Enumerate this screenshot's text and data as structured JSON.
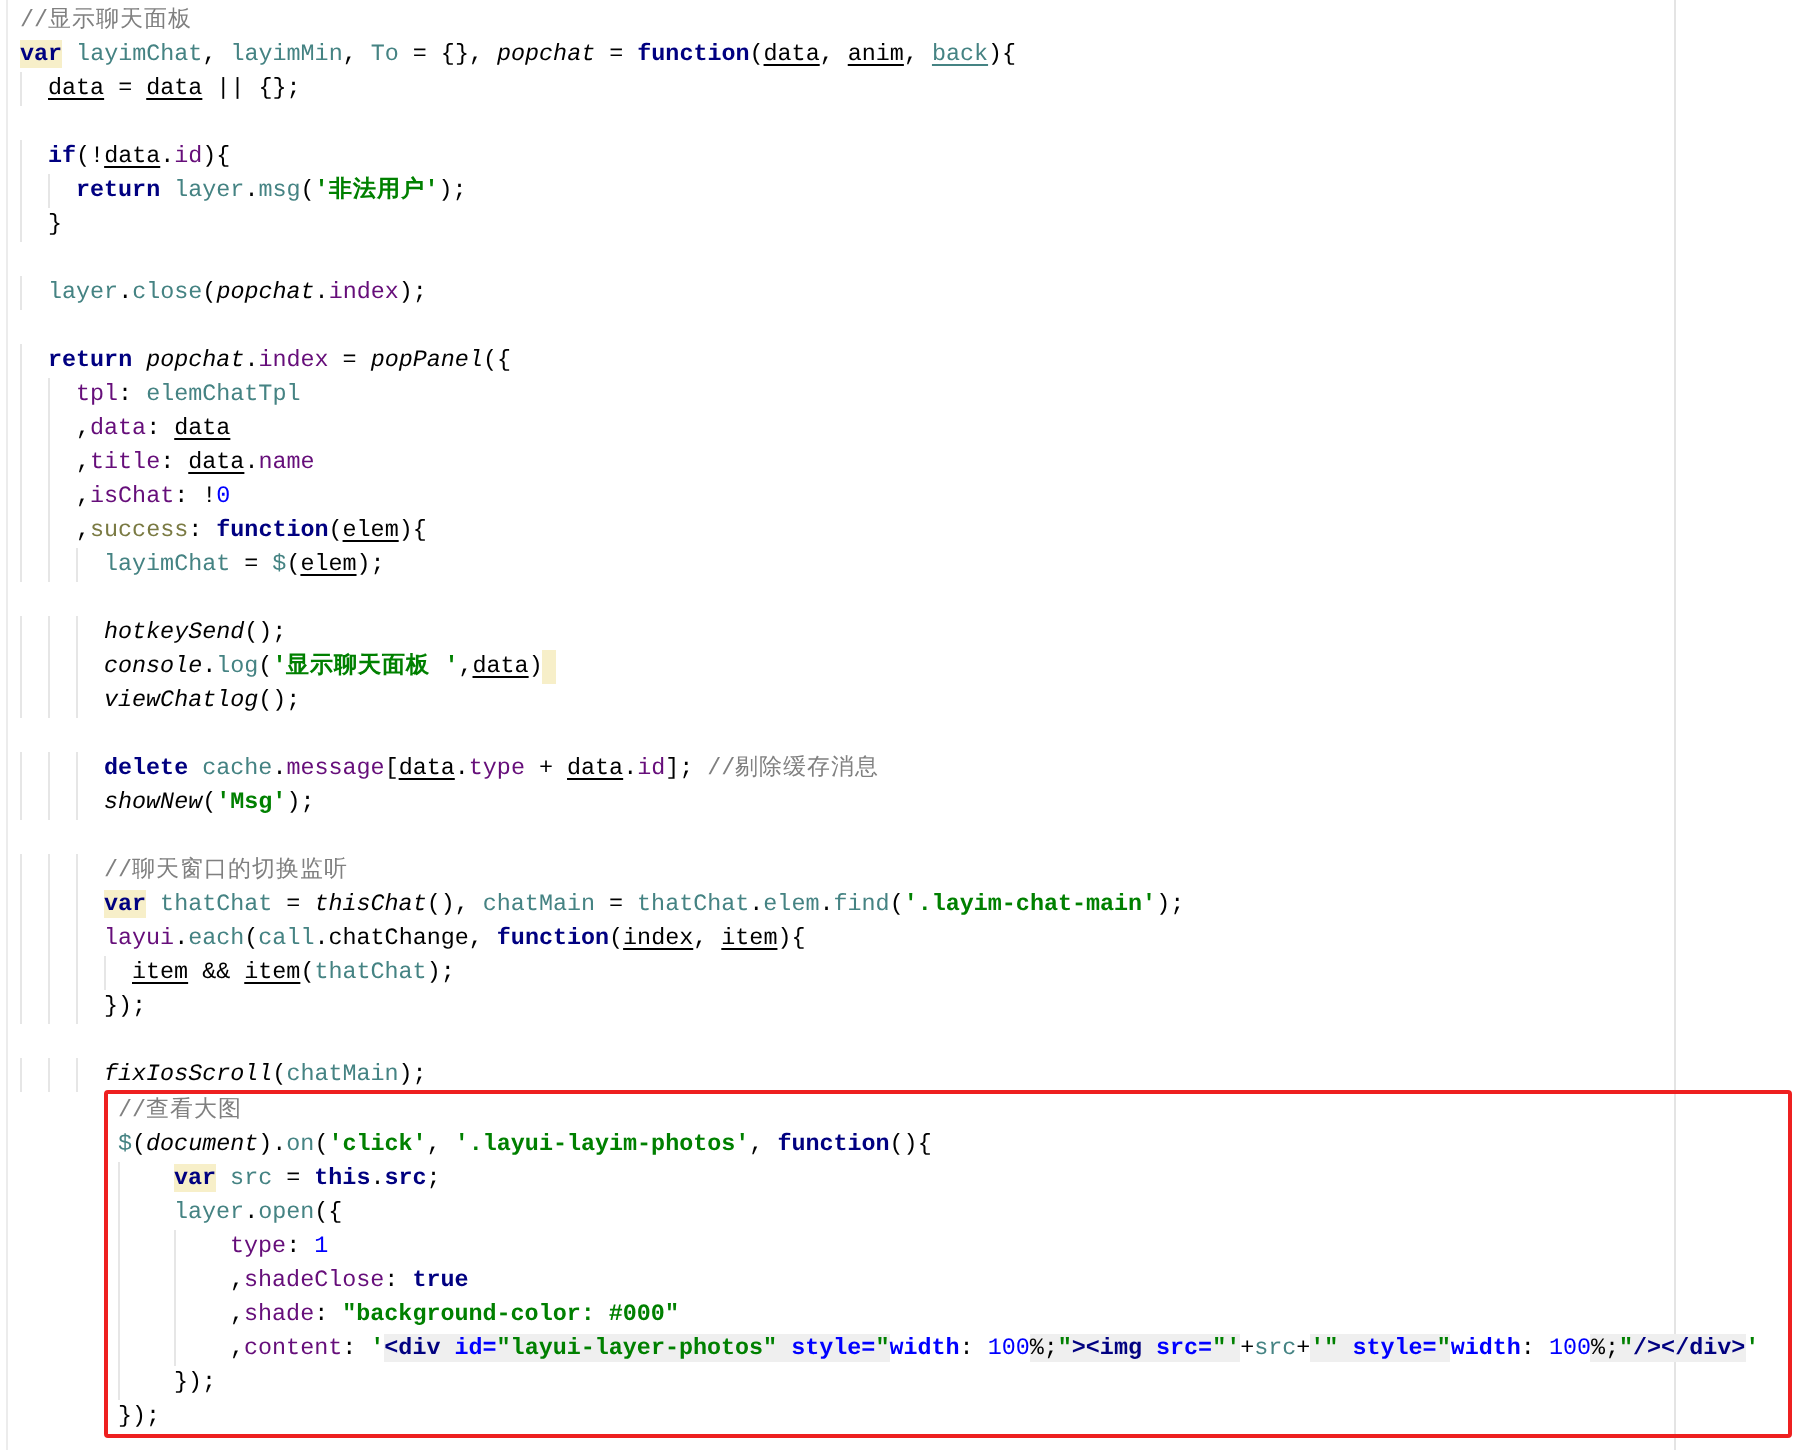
{
  "blocks": [
    {
      "boxed": false,
      "lines": [
        {
          "tokens": [
            {
              "kind": "comment",
              "text": "//显示聊天面板"
            }
          ]
        },
        {
          "tokens": [
            {
              "kind": "keyword",
              "text": "var",
              "marked": true
            },
            {
              "kind": "global",
              "text": " layimChat"
            },
            {
              "kind": "plain",
              "text": ", "
            },
            {
              "kind": "global",
              "text": "layimMin"
            },
            {
              "kind": "plain",
              "text": ", "
            },
            {
              "kind": "global",
              "text": "To"
            },
            {
              "kind": "plain",
              "text": " = {}, "
            },
            {
              "kind": "call",
              "text": "popchat"
            },
            {
              "kind": "plain",
              "text": " = "
            },
            {
              "kind": "keyword",
              "text": "function"
            },
            {
              "kind": "plain",
              "text": "("
            },
            {
              "kind": "plain",
              "text": "data",
              "underlined": true
            },
            {
              "kind": "plain",
              "text": ", "
            },
            {
              "kind": "plain",
              "text": "anim",
              "underlined": true
            },
            {
              "kind": "plain",
              "text": ", "
            },
            {
              "kind": "global",
              "text": "back",
              "underlined": true
            },
            {
              "kind": "plain",
              "text": "){"
            }
          ],
          "children": [
            {
              "tokens": [
                {
                  "kind": "plain",
                  "text": "data",
                  "underlined": true
                },
                {
                  "kind": "plain",
                  "text": " = "
                },
                {
                  "kind": "plain",
                  "text": "data",
                  "underlined": true
                },
                {
                  "kind": "plain",
                  "text": " || {};"
                }
              ]
            },
            {
              "blank_before": true,
              "tokens": [
                {
                  "kind": "keyword",
                  "text": "if"
                },
                {
                  "kind": "plain",
                  "text": "(!"
                },
                {
                  "kind": "plain",
                  "text": "data",
                  "underlined": true
                },
                {
                  "kind": "plain",
                  "text": "."
                },
                {
                  "kind": "field",
                  "text": "id"
                },
                {
                  "kind": "plain",
                  "text": "){"
                }
              ],
              "children": [
                {
                  "tokens": [
                    {
                      "kind": "keyword",
                      "text": "return"
                    },
                    {
                      "kind": "global",
                      "text": " layer"
                    },
                    {
                      "kind": "plain",
                      "text": "."
                    },
                    {
                      "kind": "global",
                      "text": "msg"
                    },
                    {
                      "kind": "plain",
                      "text": "("
                    },
                    {
                      "kind": "string",
                      "text": "'非法用户'"
                    },
                    {
                      "kind": "plain",
                      "text": ");"
                    }
                  ]
                }
              ]
            },
            {
              "tokens": [
                {
                  "kind": "plain",
                  "text": "}"
                }
              ]
            },
            {
              "blank_before": true,
              "tokens": [
                {
                  "kind": "global",
                  "text": "layer"
                },
                {
                  "kind": "plain",
                  "text": "."
                },
                {
                  "kind": "global",
                  "text": "close"
                },
                {
                  "kind": "plain",
                  "text": "("
                },
                {
                  "kind": "call",
                  "text": "popchat"
                },
                {
                  "kind": "plain",
                  "text": "."
                },
                {
                  "kind": "field",
                  "text": "index"
                },
                {
                  "kind": "plain",
                  "text": ");"
                }
              ]
            },
            {
              "blank_before": true,
              "tokens": [
                {
                  "kind": "keyword",
                  "text": "return"
                },
                {
                  "kind": "call",
                  "text": " popchat"
                },
                {
                  "kind": "plain",
                  "text": "."
                },
                {
                  "kind": "field",
                  "text": "index"
                },
                {
                  "kind": "plain",
                  "text": " = "
                },
                {
                  "kind": "call",
                  "text": "popPanel"
                },
                {
                  "kind": "plain",
                  "text": "({"
                }
              ],
              "children": [
                {
                  "tokens": [
                    {
                      "kind": "field",
                      "text": "tpl"
                    },
                    {
                      "kind": "plain",
                      "text": ": "
                    },
                    {
                      "kind": "global",
                      "text": "elemChatTpl"
                    }
                  ]
                },
                {
                  "tokens": [
                    {
                      "kind": "plain",
                      "text": ","
                    },
                    {
                      "kind": "field",
                      "text": "data"
                    },
                    {
                      "kind": "plain",
                      "text": ": "
                    },
                    {
                      "kind": "plain",
                      "text": "data",
                      "underlined": true
                    }
                  ]
                },
                {
                  "tokens": [
                    {
                      "kind": "plain",
                      "text": ","
                    },
                    {
                      "kind": "field",
                      "text": "title"
                    },
                    {
                      "kind": "plain",
                      "text": ": "
                    },
                    {
                      "kind": "plain",
                      "text": "data",
                      "underlined": true
                    },
                    {
                      "kind": "plain",
                      "text": "."
                    },
                    {
                      "kind": "field",
                      "text": "name"
                    }
                  ]
                },
                {
                  "tokens": [
                    {
                      "kind": "plain",
                      "text": ","
                    },
                    {
                      "kind": "field",
                      "text": "isChat"
                    },
                    {
                      "kind": "plain",
                      "text": ": !"
                    },
                    {
                      "kind": "number",
                      "text": "0"
                    }
                  ]
                },
                {
                  "tokens": [
                    {
                      "kind": "plain",
                      "text": ","
                    },
                    {
                      "kind": "member",
                      "text": "success"
                    },
                    {
                      "kind": "plain",
                      "text": ": "
                    },
                    {
                      "kind": "keyword",
                      "text": "function"
                    },
                    {
                      "kind": "plain",
                      "text": "("
                    },
                    {
                      "kind": "plain",
                      "text": "elem",
                      "underlined": true
                    },
                    {
                      "kind": "plain",
                      "text": "){"
                    }
                  ],
                  "children": [
                    {
                      "tokens": [
                        {
                          "kind": "global",
                          "text": "layimChat"
                        },
                        {
                          "kind": "plain",
                          "text": " = "
                        },
                        {
                          "kind": "global",
                          "text": "$"
                        },
                        {
                          "kind": "plain",
                          "text": "("
                        },
                        {
                          "kind": "plain",
                          "text": "elem",
                          "underlined": true
                        },
                        {
                          "kind": "plain",
                          "text": ");"
                        }
                      ]
                    },
                    {
                      "blank_before": true,
                      "tokens": [
                        {
                          "kind": "call",
                          "text": "hotkeySend"
                        },
                        {
                          "kind": "plain",
                          "text": "();"
                        }
                      ]
                    },
                    {
                      "caret": true,
                      "tokens": [
                        {
                          "kind": "call",
                          "text": "console"
                        },
                        {
                          "kind": "plain",
                          "text": "."
                        },
                        {
                          "kind": "global",
                          "text": "log"
                        },
                        {
                          "kind": "plain",
                          "text": "("
                        },
                        {
                          "kind": "string",
                          "text": "'显示聊天面板 '"
                        },
                        {
                          "kind": "plain",
                          "text": ","
                        },
                        {
                          "kind": "plain",
                          "text": "data",
                          "underlined": true
                        },
                        {
                          "kind": "plain",
                          "text": ")"
                        }
                      ]
                    },
                    {
                      "tokens": [
                        {
                          "kind": "call",
                          "text": "viewChatlog"
                        },
                        {
                          "kind": "plain",
                          "text": "();"
                        }
                      ]
                    },
                    {
                      "blank_before": true,
                      "tokens": [
                        {
                          "kind": "keyword",
                          "text": "delete"
                        },
                        {
                          "kind": "global",
                          "text": " cache"
                        },
                        {
                          "kind": "plain",
                          "text": "."
                        },
                        {
                          "kind": "field",
                          "text": "message"
                        },
                        {
                          "kind": "plain",
                          "text": "["
                        },
                        {
                          "kind": "plain",
                          "text": "data",
                          "underlined": true
                        },
                        {
                          "kind": "plain",
                          "text": "."
                        },
                        {
                          "kind": "field",
                          "text": "type"
                        },
                        {
                          "kind": "plain",
                          "text": " + "
                        },
                        {
                          "kind": "plain",
                          "text": "data",
                          "underlined": true
                        },
                        {
                          "kind": "plain",
                          "text": "."
                        },
                        {
                          "kind": "field",
                          "text": "id"
                        },
                        {
                          "kind": "plain",
                          "text": "]; "
                        },
                        {
                          "kind": "comment",
                          "text": "//剔除缓存消息"
                        }
                      ]
                    },
                    {
                      "tokens": [
                        {
                          "kind": "call",
                          "text": "showNew"
                        },
                        {
                          "kind": "plain",
                          "text": "("
                        },
                        {
                          "kind": "string",
                          "text": "'Msg'"
                        },
                        {
                          "kind": "plain",
                          "text": ");"
                        }
                      ]
                    },
                    {
                      "blank_before": true,
                      "tokens": [
                        {
                          "kind": "comment",
                          "text": "//聊天窗口的切换监听"
                        }
                      ]
                    },
                    {
                      "tokens": [
                        {
                          "kind": "keyword",
                          "text": "var",
                          "marked": true
                        },
                        {
                          "kind": "global",
                          "text": " thatChat"
                        },
                        {
                          "kind": "plain",
                          "text": " = "
                        },
                        {
                          "kind": "call",
                          "text": "thisChat"
                        },
                        {
                          "kind": "plain",
                          "text": "(), "
                        },
                        {
                          "kind": "global",
                          "text": "chatMain"
                        },
                        {
                          "kind": "plain",
                          "text": " = "
                        },
                        {
                          "kind": "global",
                          "text": "thatChat"
                        },
                        {
                          "kind": "plain",
                          "text": "."
                        },
                        {
                          "kind": "global",
                          "text": "elem"
                        },
                        {
                          "kind": "plain",
                          "text": "."
                        },
                        {
                          "kind": "global",
                          "text": "find"
                        },
                        {
                          "kind": "plain",
                          "text": "("
                        },
                        {
                          "kind": "string",
                          "text": "'.layim-chat-main'"
                        },
                        {
                          "kind": "plain",
                          "text": ");"
                        }
                      ]
                    },
                    {
                      "tokens": [
                        {
                          "kind": "field",
                          "text": "layui"
                        },
                        {
                          "kind": "plain",
                          "text": "."
                        },
                        {
                          "kind": "global",
                          "text": "each"
                        },
                        {
                          "kind": "plain",
                          "text": "("
                        },
                        {
                          "kind": "global",
                          "text": "call"
                        },
                        {
                          "kind": "plain",
                          "text": "."
                        },
                        {
                          "kind": "plain",
                          "text": "chatChange"
                        },
                        {
                          "kind": "plain",
                          "text": ", "
                        },
                        {
                          "kind": "keyword",
                          "text": "function"
                        },
                        {
                          "kind": "plain",
                          "text": "("
                        },
                        {
                          "kind": "plain",
                          "text": "index",
                          "underlined": true
                        },
                        {
                          "kind": "plain",
                          "text": ", "
                        },
                        {
                          "kind": "plain",
                          "text": "item",
                          "underlined": true
                        },
                        {
                          "kind": "plain",
                          "text": "){"
                        }
                      ],
                      "children": [
                        {
                          "tokens": [
                            {
                              "kind": "plain",
                              "text": "item",
                              "underlined": true
                            },
                            {
                              "kind": "plain",
                              "text": " && "
                            },
                            {
                              "kind": "plain",
                              "text": "item",
                              "underlined": true
                            },
                            {
                              "kind": "plain",
                              "text": "("
                            },
                            {
                              "kind": "global",
                              "text": "thatChat"
                            },
                            {
                              "kind": "plain",
                              "text": ");"
                            }
                          ]
                        }
                      ]
                    },
                    {
                      "tokens": [
                        {
                          "kind": "plain",
                          "text": "});"
                        }
                      ]
                    },
                    {
                      "blank_before": true,
                      "tokens": [
                        {
                          "kind": "call",
                          "text": "fixIosScroll"
                        },
                        {
                          "kind": "plain",
                          "text": "("
                        },
                        {
                          "kind": "global",
                          "text": "chatMain"
                        },
                        {
                          "kind": "plain",
                          "text": ");"
                        }
                      ]
                    }
                  ]
                }
              ]
            }
          ]
        }
      ]
    },
    {
      "boxed": true,
      "lines": [
        {
          "tokens": [
            {
              "kind": "comment",
              "text": "//查看大图"
            }
          ]
        },
        {
          "tokens": [
            {
              "kind": "global",
              "text": "$"
            },
            {
              "kind": "plain",
              "text": "("
            },
            {
              "kind": "call",
              "text": "document"
            },
            {
              "kind": "plain",
              "text": ")."
            },
            {
              "kind": "global",
              "text": "on"
            },
            {
              "kind": "plain",
              "text": "("
            },
            {
              "kind": "string",
              "text": "'click'"
            },
            {
              "kind": "plain",
              "text": ", "
            },
            {
              "kind": "string",
              "text": "'.layui-layim-photos'"
            },
            {
              "kind": "plain",
              "text": ", "
            },
            {
              "kind": "keyword",
              "text": "function"
            },
            {
              "kind": "plain",
              "text": "(){"
            }
          ],
          "children": [
            {
              "tokens": [
                {
                  "kind": "keyword",
                  "text": "var",
                  "marked": true
                },
                {
                  "kind": "global",
                  "text": " src"
                },
                {
                  "kind": "plain",
                  "text": " = "
                },
                {
                  "kind": "keyword",
                  "text": "this"
                },
                {
                  "kind": "plain",
                  "text": "."
                },
                {
                  "kind": "keyword",
                  "text": "src"
                },
                {
                  "kind": "plain",
                  "text": ";"
                }
              ]
            },
            {
              "tokens": [
                {
                  "kind": "global",
                  "text": "layer"
                },
                {
                  "kind": "plain",
                  "text": "."
                },
                {
                  "kind": "global",
                  "text": "open"
                },
                {
                  "kind": "plain",
                  "text": "({"
                }
              ],
              "children": [
                {
                  "tokens": [
                    {
                      "kind": "field",
                      "text": "type"
                    },
                    {
                      "kind": "plain",
                      "text": ": "
                    },
                    {
                      "kind": "number",
                      "text": "1"
                    }
                  ]
                },
                {
                  "tokens": [
                    {
                      "kind": "plain",
                      "text": ","
                    },
                    {
                      "kind": "field",
                      "text": "shadeClose"
                    },
                    {
                      "kind": "plain",
                      "text": ": "
                    },
                    {
                      "kind": "keyword",
                      "text": "true"
                    }
                  ]
                },
                {
                  "tokens": [
                    {
                      "kind": "plain",
                      "text": ","
                    },
                    {
                      "kind": "field",
                      "text": "shade"
                    },
                    {
                      "kind": "plain",
                      "text": ": "
                    },
                    {
                      "kind": "string",
                      "text": "\"background-color: #000\""
                    }
                  ]
                },
                {
                  "tokens": [
                    {
                      "kind": "plain",
                      "text": ","
                    },
                    {
                      "kind": "field",
                      "text": "content"
                    },
                    {
                      "kind": "plain",
                      "text": ": "
                    },
                    {
                      "kind": "string",
                      "text": "'"
                    },
                    {
                      "kind": "tag",
                      "text": "<div",
                      "shaded": true
                    },
                    {
                      "kind": "attr",
                      "text": " id=",
                      "shaded": true
                    },
                    {
                      "kind": "string",
                      "text": "\"layui-layer-photos\"",
                      "shaded": true
                    },
                    {
                      "kind": "attr",
                      "text": " style=",
                      "shaded": true
                    },
                    {
                      "kind": "string",
                      "text": "\"",
                      "shaded": true
                    },
                    {
                      "kind": "attr",
                      "text": "width"
                    },
                    {
                      "kind": "plain",
                      "text": ": "
                    },
                    {
                      "kind": "number",
                      "text": "100"
                    },
                    {
                      "kind": "plain",
                      "text": "%;",
                      "shaded": true
                    },
                    {
                      "kind": "string",
                      "text": "\"",
                      "shaded": true
                    },
                    {
                      "kind": "tag",
                      "text": "><img",
                      "shaded": true
                    },
                    {
                      "kind": "attr",
                      "text": " src=",
                      "shaded": true
                    },
                    {
                      "kind": "string",
                      "text": "\"'",
                      "shaded": true
                    },
                    {
                      "kind": "plain",
                      "text": "+"
                    },
                    {
                      "kind": "global",
                      "text": "src"
                    },
                    {
                      "kind": "plain",
                      "text": "+"
                    },
                    {
                      "kind": "string",
                      "text": "'\"",
                      "shaded": true
                    },
                    {
                      "kind": "attr",
                      "text": " style=",
                      "shaded": true
                    },
                    {
                      "kind": "string",
                      "text": "\"",
                      "shaded": true
                    },
                    {
                      "kind": "attr",
                      "text": "width"
                    },
                    {
                      "kind": "plain",
                      "text": ": "
                    },
                    {
                      "kind": "number",
                      "text": "100"
                    },
                    {
                      "kind": "plain",
                      "text": "%;",
                      "shaded": true
                    },
                    {
                      "kind": "string",
                      "text": "\"",
                      "shaded": true
                    },
                    {
                      "kind": "tag",
                      "text": "/></div>",
                      "shaded": true
                    },
                    {
                      "kind": "string",
                      "text": "'"
                    }
                  ]
                }
              ]
            },
            {
              "tokens": [
                {
                  "kind": "plain",
                  "text": "});"
                }
              ]
            }
          ]
        },
        {
          "tokens": [
            {
              "kind": "plain",
              "text": "});"
            }
          ]
        }
      ]
    }
  ]
}
